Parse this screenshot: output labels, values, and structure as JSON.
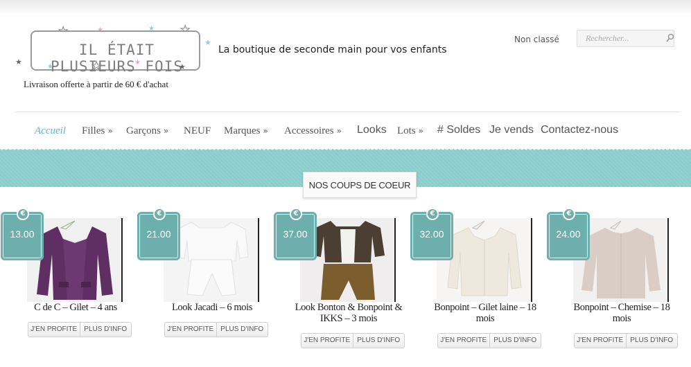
{
  "header": {
    "logo_text": "IL ÉTAIT PLUSIEURS FOIS",
    "tagline": "La boutique de seconde main pour vos enfants",
    "shipping_note": "Livraison offerte à partir de 60 € d'achat",
    "category_link": "Non classé",
    "search_placeholder": "Rechercher..."
  },
  "nav": {
    "items": [
      {
        "label": "Accueil",
        "active": true
      },
      {
        "label": "Filles",
        "submenu": true
      },
      {
        "label": "Garçons",
        "submenu": true
      },
      {
        "label": "NEUF"
      },
      {
        "label": "Marques",
        "submenu": true
      },
      {
        "label": "Accessoires",
        "submenu": true
      },
      {
        "label": "Looks"
      },
      {
        "label": "Lots",
        "submenu": true
      },
      {
        "label": "# Soldes"
      },
      {
        "label": "Je vends"
      },
      {
        "label": "Contactez-nous"
      }
    ],
    "chevron": "»"
  },
  "section": {
    "title": "NOS COUPS DE COEUR"
  },
  "products": [
    {
      "price": "13.00",
      "currency": "€",
      "title": "C de C – Gilet – 4 ans",
      "buy_label": "J'EN PROFITE",
      "info_label": "PLUS D'INFO",
      "garment": "purple cardigan"
    },
    {
      "price": "21.00",
      "currency": "€",
      "title": "Look Jacadi – 6 mois",
      "buy_label": "J'EN PROFITE",
      "info_label": "PLUS D'INFO",
      "garment": "white outfit"
    },
    {
      "price": "37.00",
      "currency": "€",
      "title": "Look Bonton & Bonpoint & IKKS – 3 mois",
      "buy_label": "J'EN PROFITE",
      "info_label": "PLUS D'INFO",
      "garment": "brown cardigan and trousers"
    },
    {
      "price": "32.00",
      "currency": "€",
      "title": "Bonpoint – Gilet laine – 18 mois",
      "buy_label": "J'EN PROFITE",
      "info_label": "PLUS D'INFO",
      "garment": "cream wool cardigan"
    },
    {
      "price": "24.00",
      "currency": "€",
      "title": "Bonpoint – Chemise – 18 mois",
      "buy_label": "J'EN PROFITE",
      "info_label": "PLUS D'INFO",
      "garment": "beige shirt"
    }
  ],
  "colors": {
    "accent": "#6cb2b5",
    "band": "#8ccccc",
    "tag": "#6dafad"
  }
}
